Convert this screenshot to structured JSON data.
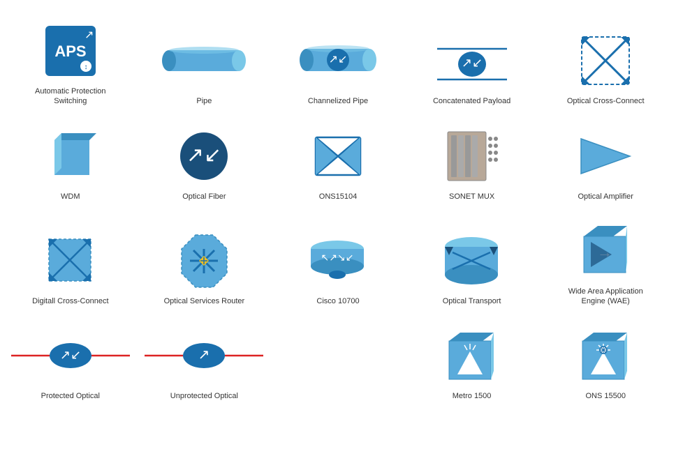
{
  "items": [
    {
      "id": "aps",
      "label": "Automatic Protection\nSwitching"
    },
    {
      "id": "pipe",
      "label": "Pipe"
    },
    {
      "id": "cpipe",
      "label": "Channelized Pipe"
    },
    {
      "id": "concat",
      "label": "Concatenated Payload"
    },
    {
      "id": "occ",
      "label": "Optical Cross-Connect"
    },
    {
      "id": "wdm",
      "label": "WDM"
    },
    {
      "id": "optfiber",
      "label": "Optical Fiber"
    },
    {
      "id": "ons15104",
      "label": "ONS15104"
    },
    {
      "id": "sonetmux",
      "label": "SONET MUX"
    },
    {
      "id": "oamp",
      "label": "Optical Amplifier"
    },
    {
      "id": "dcc",
      "label": "Digitall Cross-Connect"
    },
    {
      "id": "osr",
      "label": "Optical Services Router"
    },
    {
      "id": "cisco10700",
      "label": "Cisco 10700"
    },
    {
      "id": "ot",
      "label": "Optical Transport"
    },
    {
      "id": "wae",
      "label": "Wide Area Application\nEngine (WAE)"
    },
    {
      "id": "protopt",
      "label": "Protected Optical"
    },
    {
      "id": "unprotopt",
      "label": "Unprotected Optical"
    },
    {
      "id": "empty1",
      "label": ""
    },
    {
      "id": "metro1500",
      "label": "Metro 1500"
    },
    {
      "id": "ons15500",
      "label": "ONS 15500"
    }
  ]
}
